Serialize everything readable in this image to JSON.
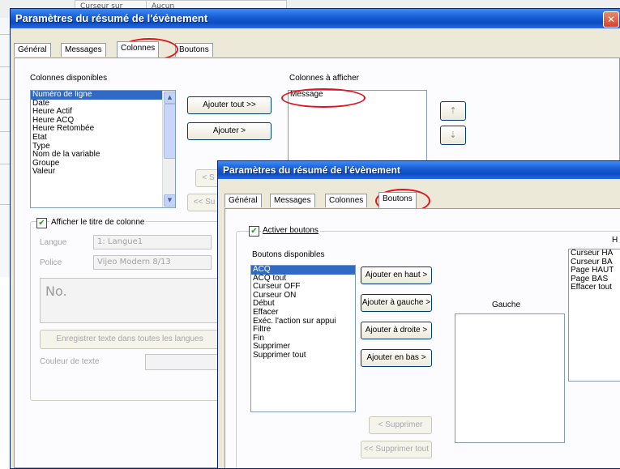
{
  "background": {
    "cells": [
      "Curseur sur action",
      "Aucun"
    ]
  },
  "dialog1": {
    "title": "Paramètres du résumé de l'évènement",
    "close": "✕",
    "tabs": [
      "Général",
      "Messages",
      "Colonnes",
      "Boutons"
    ],
    "active_tab": "Colonnes",
    "available_label": "Colonnes disponibles",
    "available_items": [
      "Numéro de ligne",
      "Date",
      "Heure Actif",
      "Heure ACQ",
      "Heure Retombée",
      "Etat",
      "Type",
      "Nom de la variable",
      "Groupe",
      "Valeur"
    ],
    "selected_available": "Numéro de ligne",
    "shown_label": "Colonnes à afficher",
    "shown_items": [
      "Message"
    ],
    "btn_add_all": "Ajouter tout >>",
    "btn_add": "Ajouter >",
    "btn_remove_partial": "< S",
    "btn_remove_all_partial": "<< Su",
    "up_icon": "⇡",
    "down_icon": "⇣",
    "show_title_checkbox": "Afficher le titre de colonne",
    "show_title_checked": true,
    "language_label": "Langue",
    "language_value": "1: Langue1",
    "font_label": "Police",
    "font_value": "Vijeo Modern 8/13",
    "preview_text": "No.",
    "save_all_lang_btn": "Enregistrer texte dans toutes les langues",
    "text_color_label": "Couleur de texte"
  },
  "dialog2": {
    "title": "Paramètres du résumé de l'évènement",
    "tabs": [
      "Général",
      "Messages",
      "Colonnes",
      "Boutons"
    ],
    "active_tab": "Boutons",
    "activate_checkbox": "Activer boutons",
    "activate_checked": true,
    "available_label": "Boutons disponibles",
    "available_items": [
      "ACQ",
      "ACQ tout",
      "Curseur OFF",
      "Curseur ON",
      "Début",
      "Effacer",
      "Exéc. l'action sur appui",
      "Filtre",
      "Fin",
      "Supprimer",
      "Supprimer tout"
    ],
    "selected_available": "ACQ",
    "btn_add_top": "Ajouter en haut >",
    "btn_add_left": "Ajouter à gauche >",
    "btn_add_right": "Ajouter à droite >",
    "btn_add_bottom": "Ajouter en bas >",
    "btn_remove": "< Supprimer",
    "btn_remove_all": "<< Supprimer tout",
    "left_label": "Gauche",
    "top_label_partial": "H",
    "top_items": [
      "Curseur HA",
      "Curseur BA",
      "Page HAUT",
      "Page BAS",
      "Effacer tout"
    ]
  }
}
